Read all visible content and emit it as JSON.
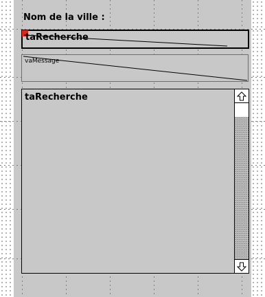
{
  "form": {
    "label": "Nom de la ville :",
    "search_field": {
      "value": "taRecherche"
    },
    "message_field": {
      "value": "vaMessage"
    },
    "list_field": {
      "value": "taRecherche"
    }
  },
  "icons": {
    "scroll_up": "arrow-up-icon",
    "scroll_down": "arrow-down-icon"
  },
  "colors": {
    "panel_bg": "#c8c8c8",
    "marker": "#d62a1e"
  }
}
